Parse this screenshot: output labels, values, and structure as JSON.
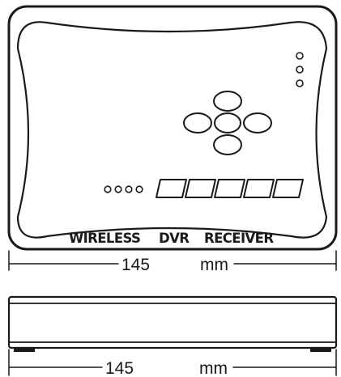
{
  "top_view": {
    "label_brand": "WIRELESS",
    "label_product": "DVR",
    "label_type": "RECEIVER",
    "dimension_value": "145",
    "dimension_unit": "mm"
  },
  "side_view": {
    "dimension_value": "145",
    "dimension_unit": "mm"
  },
  "colors": {
    "line": "#1a1a1a",
    "background": "#ffffff"
  }
}
